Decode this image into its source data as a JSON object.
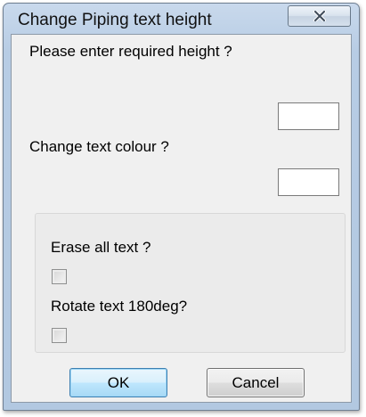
{
  "dialog": {
    "title": "Change Piping text height",
    "close_icon": "close-x-icon"
  },
  "fields": {
    "height_label": "Please enter required height ?",
    "height_value": "",
    "colour_label": "Change text colour ?",
    "colour_value": ""
  },
  "options": {
    "erase_label": "Erase all text ?",
    "erase_checked": false,
    "rotate_label": "Rotate text 180deg?",
    "rotate_checked": false
  },
  "buttons": {
    "ok_label": "OK",
    "cancel_label": "Cancel"
  },
  "colors": {
    "title_bar": "#b7cce4",
    "client_bg": "#f0f0f0",
    "ok_border": "#3c7fb1"
  }
}
